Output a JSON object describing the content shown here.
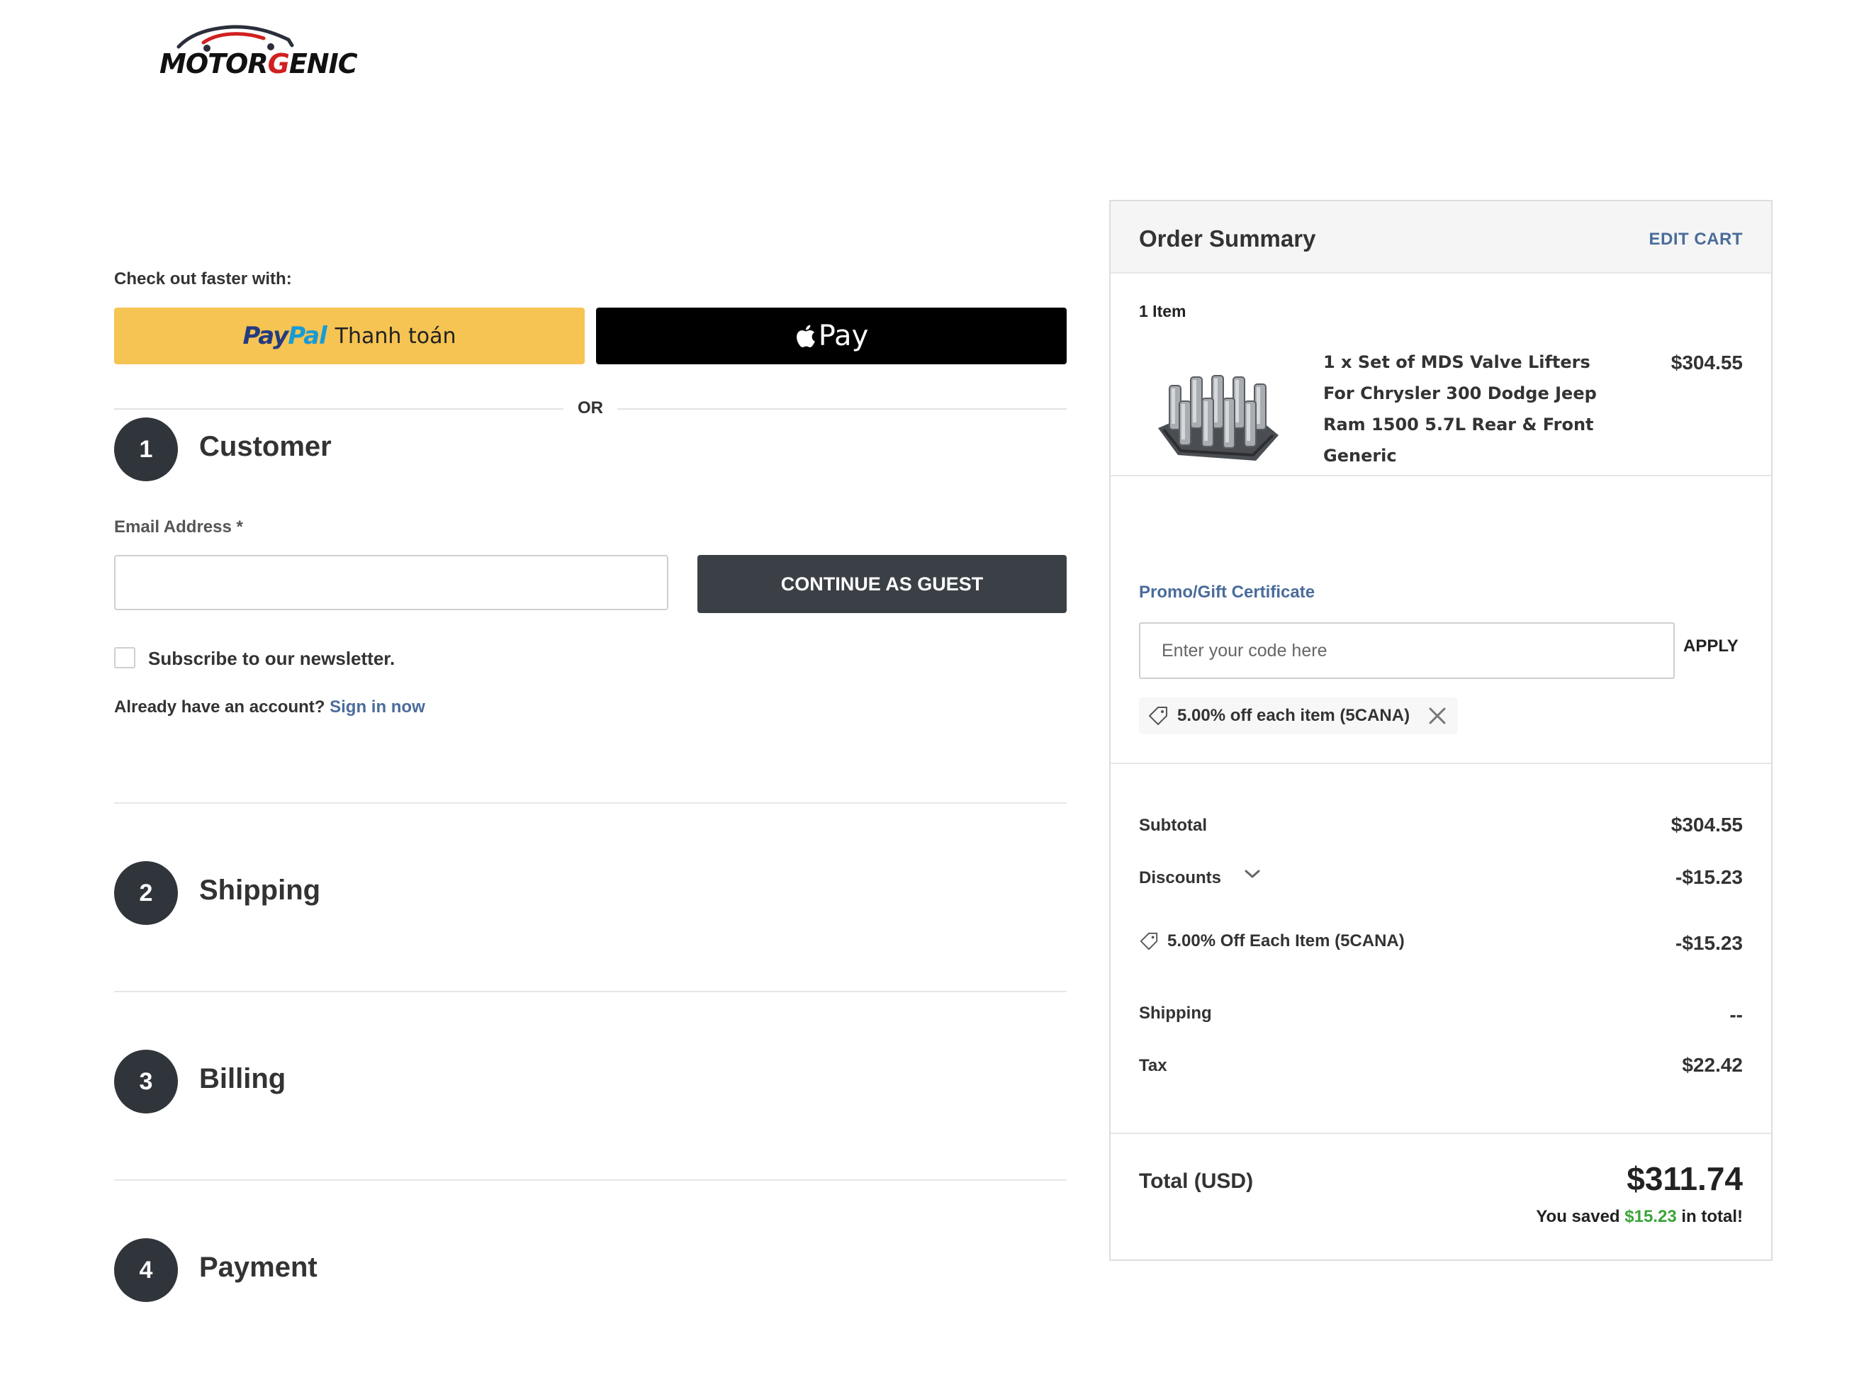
{
  "brand": {
    "name_main": "MOTOR",
    "name_accent": "G",
    "name_rest": "ENIC",
    "accent_color": "#d0201f"
  },
  "express": {
    "label": "Check out faster with:",
    "paypal": {
      "brand_part1": "Pay",
      "brand_part2": "Pal",
      "text": "Thanh toán"
    },
    "applepay": {
      "text": "Pay"
    },
    "or": "OR"
  },
  "steps": [
    {
      "number": "1",
      "title": "Customer"
    },
    {
      "number": "2",
      "title": "Shipping"
    },
    {
      "number": "3",
      "title": "Billing"
    },
    {
      "number": "4",
      "title": "Payment"
    }
  ],
  "customer": {
    "email_label": "Email Address *",
    "email_value": "",
    "continue_label": "CONTINUE AS GUEST",
    "newsletter_label": "Subscribe to our newsletter.",
    "newsletter_checked": false,
    "account_prompt": "Already have an account?",
    "signin_label": "Sign in now"
  },
  "summary": {
    "title": "Order Summary",
    "edit_cart": "EDIT CART",
    "item_count": "1 Item",
    "items": [
      {
        "name": "1 x Set of MDS Valve Lifters For Chrysler 300 Dodge Jeep Ram 1500 5.7L Rear & Front Generic",
        "price": "$304.55"
      }
    ],
    "promo": {
      "label": "Promo/Gift Certificate",
      "placeholder": "Enter your code here",
      "apply": "APPLY",
      "applied_coupon": "5.00% off each item (5CANA)"
    },
    "lines": {
      "subtotal_label": "Subtotal",
      "subtotal_value": "$304.55",
      "discounts_label": "Discounts",
      "discounts_value": "-$15.23",
      "coupon_line_label": "5.00% Off Each Item (5CANA)",
      "coupon_line_value": "-$15.23",
      "shipping_label": "Shipping",
      "shipping_value": "--",
      "tax_label": "Tax",
      "tax_value": "$22.42"
    },
    "total": {
      "label": "Total (USD)",
      "value": "$311.74",
      "saved_prefix": "You saved",
      "saved_amount": "$15.23",
      "saved_suffix": "in total!",
      "saved_color": "#3ca43a"
    }
  }
}
